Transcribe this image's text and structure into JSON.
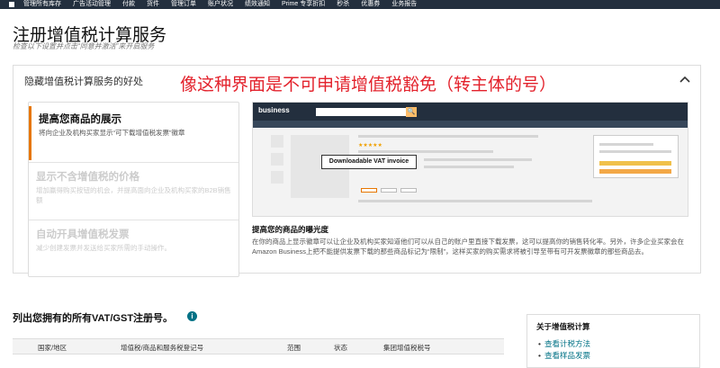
{
  "nav": {
    "items": [
      "管理所有库存",
      "广告活动管理",
      "付款",
      "货件",
      "管理订单",
      "账户状况",
      "绩效通知",
      "Prime 专享折扣",
      "秒杀",
      "优惠券",
      "业务报告"
    ]
  },
  "page": {
    "title": "注册增值税计算服务",
    "subtitle": "检查以下设置并点击“同意并激活”来开启服务"
  },
  "panel": {
    "header": "隐藏增值税计算服务的好处",
    "annotation": "像这种界面是不可申请增值税豁免（转主体的号）",
    "benefits": [
      {
        "title": "提高您商品的展示",
        "desc": "将向企业及机构买家显示“可下载增值税发票”徽章"
      },
      {
        "title": "显示不含增值税的价格",
        "desc": "增加赢得购买按钮的机会，并提高面向企业及机构买家的B2B销售额"
      },
      {
        "title": "自动开具增值税发票",
        "desc": "减少创建发票并发送给买家所需的手动操作。"
      }
    ],
    "preview": {
      "logo": "business",
      "search_icon": "🔍",
      "stars": "★★★★★",
      "tooltip": "Downloadable VAT invoice"
    },
    "visibility_title": "提高您的商品的曝光度",
    "visibility_desc": "在你的商品上显示徽章可以让企业及机构买家知道他们可以从自己的账户里直接下载发票，这可以提高你的销售转化率。另外，许多企业买家会在Amazon Business上把不能提供发票下载的那些商品标记为“限制”，这样买家的购买需求将被引导至带有可开发票徽章的那些商品去。"
  },
  "registration": {
    "title": "列出您拥有的所有VAT/GST注册号。",
    "info_icon": "i",
    "columns": [
      "国家/地区",
      "增值税/商品和服务税登记号",
      "范围",
      "状态",
      "集团增值税税号"
    ]
  },
  "side": {
    "title": "关于增值税计算",
    "links": [
      "查看计税方法",
      "查看样品发票"
    ]
  },
  "colors": {
    "nav_bg": "#232f3e",
    "accent": "#e77600",
    "annotation": "#e3222c",
    "link": "#007185"
  }
}
